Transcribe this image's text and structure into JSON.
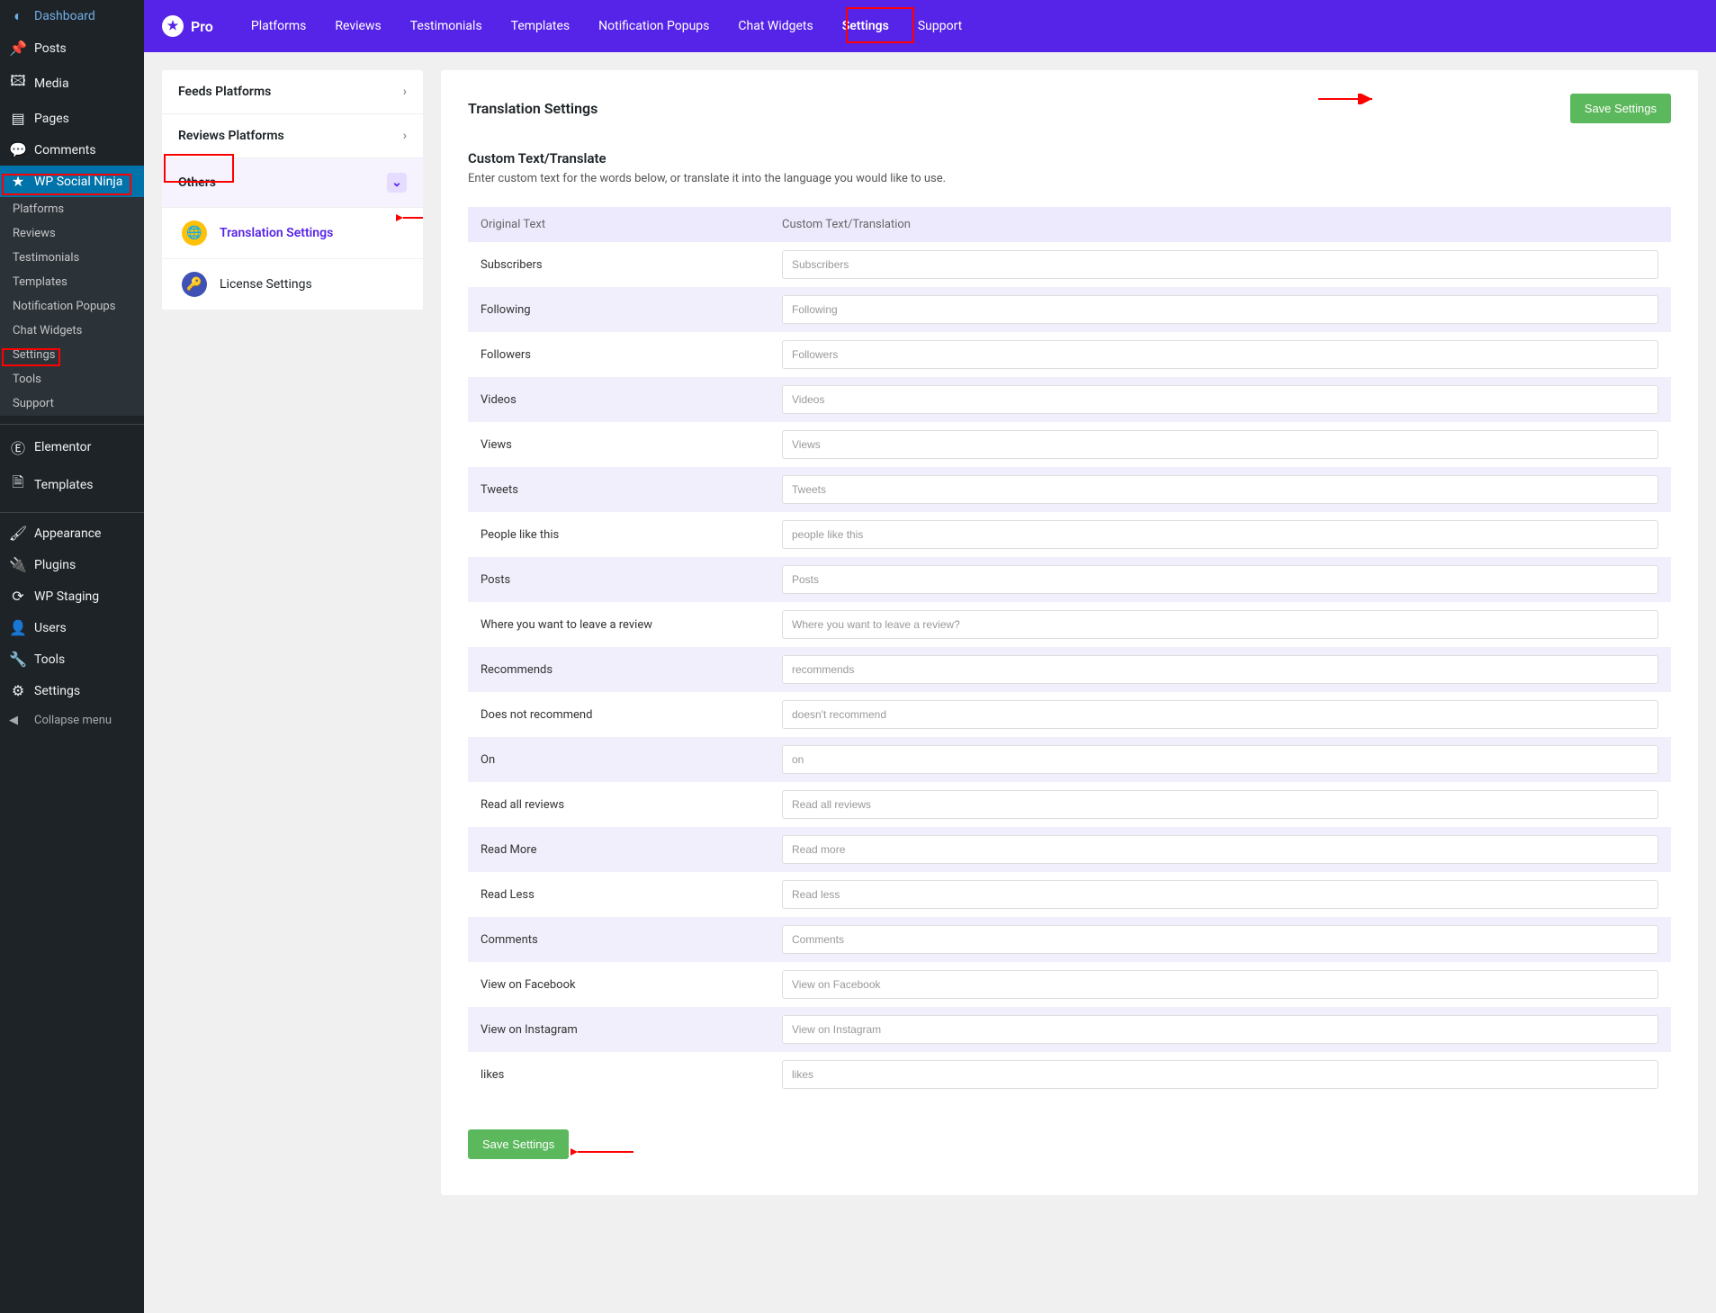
{
  "wpSidebar": {
    "items": [
      {
        "label": "Dashboard",
        "icon": "◐"
      },
      {
        "label": "Posts",
        "icon": "📌"
      },
      {
        "label": "Media",
        "icon": "🖾"
      },
      {
        "label": "Pages",
        "icon": "▤"
      },
      {
        "label": "Comments",
        "icon": "💬"
      },
      {
        "label": "WP Social Ninja",
        "icon": "★",
        "active": true
      }
    ],
    "subItems": [
      "Platforms",
      "Reviews",
      "Testimonials",
      "Templates",
      "Notification Popups",
      "Chat Widgets",
      "Settings",
      "Tools",
      "Support"
    ],
    "items2": [
      {
        "label": "Elementor",
        "icon": "Ⓔ"
      },
      {
        "label": "Templates",
        "icon": "🗎"
      }
    ],
    "items3": [
      {
        "label": "Appearance",
        "icon": "🖌"
      },
      {
        "label": "Plugins",
        "icon": "🔌"
      },
      {
        "label": "WP Staging",
        "icon": "⟳"
      },
      {
        "label": "Users",
        "icon": "👤"
      },
      {
        "label": "Tools",
        "icon": "🔧"
      },
      {
        "label": "Settings",
        "icon": "⚙"
      }
    ],
    "collapse": "Collapse menu"
  },
  "topBar": {
    "logo": "Pro",
    "nav": [
      "Platforms",
      "Reviews",
      "Testimonials",
      "Templates",
      "Notification Popups",
      "Chat Widgets",
      "Settings",
      "Support"
    ]
  },
  "settingsSidebar": {
    "cats": [
      {
        "label": "Feeds Platforms"
      },
      {
        "label": "Reviews Platforms"
      },
      {
        "label": "Others",
        "expanded": true
      }
    ],
    "subItems": [
      {
        "label": "Translation Settings",
        "active": true
      },
      {
        "label": "License Settings"
      }
    ]
  },
  "panel": {
    "title": "Translation Settings",
    "saveBtn": "Save Settings",
    "sectionTitle": "Custom Text/Translate",
    "sectionDesc": "Enter custom text for the words below, or translate it into the language you would like to use.",
    "headerOriginal": "Original Text",
    "headerCustom": "Custom Text/Translation",
    "rows": [
      {
        "original": "Subscribers",
        "placeholder": "Subscribers"
      },
      {
        "original": "Following",
        "placeholder": "Following"
      },
      {
        "original": "Followers",
        "placeholder": "Followers"
      },
      {
        "original": "Videos",
        "placeholder": "Videos"
      },
      {
        "original": "Views",
        "placeholder": "Views"
      },
      {
        "original": "Tweets",
        "placeholder": "Tweets"
      },
      {
        "original": "People like this",
        "placeholder": "people like this"
      },
      {
        "original": "Posts",
        "placeholder": "Posts"
      },
      {
        "original": "Where you want to leave a review",
        "placeholder": "Where you want to leave a review?"
      },
      {
        "original": "Recommends",
        "placeholder": "recommends"
      },
      {
        "original": "Does not recommend",
        "placeholder": "doesn't recommend"
      },
      {
        "original": "On",
        "placeholder": "on"
      },
      {
        "original": "Read all reviews",
        "placeholder": "Read all reviews"
      },
      {
        "original": "Read More",
        "placeholder": "Read more"
      },
      {
        "original": "Read Less",
        "placeholder": "Read less"
      },
      {
        "original": "Comments",
        "placeholder": "Comments"
      },
      {
        "original": "View on Facebook",
        "placeholder": "View on Facebook"
      },
      {
        "original": "View on Instagram",
        "placeholder": "View on Instagram"
      },
      {
        "original": "likes",
        "placeholder": "likes"
      }
    ]
  }
}
